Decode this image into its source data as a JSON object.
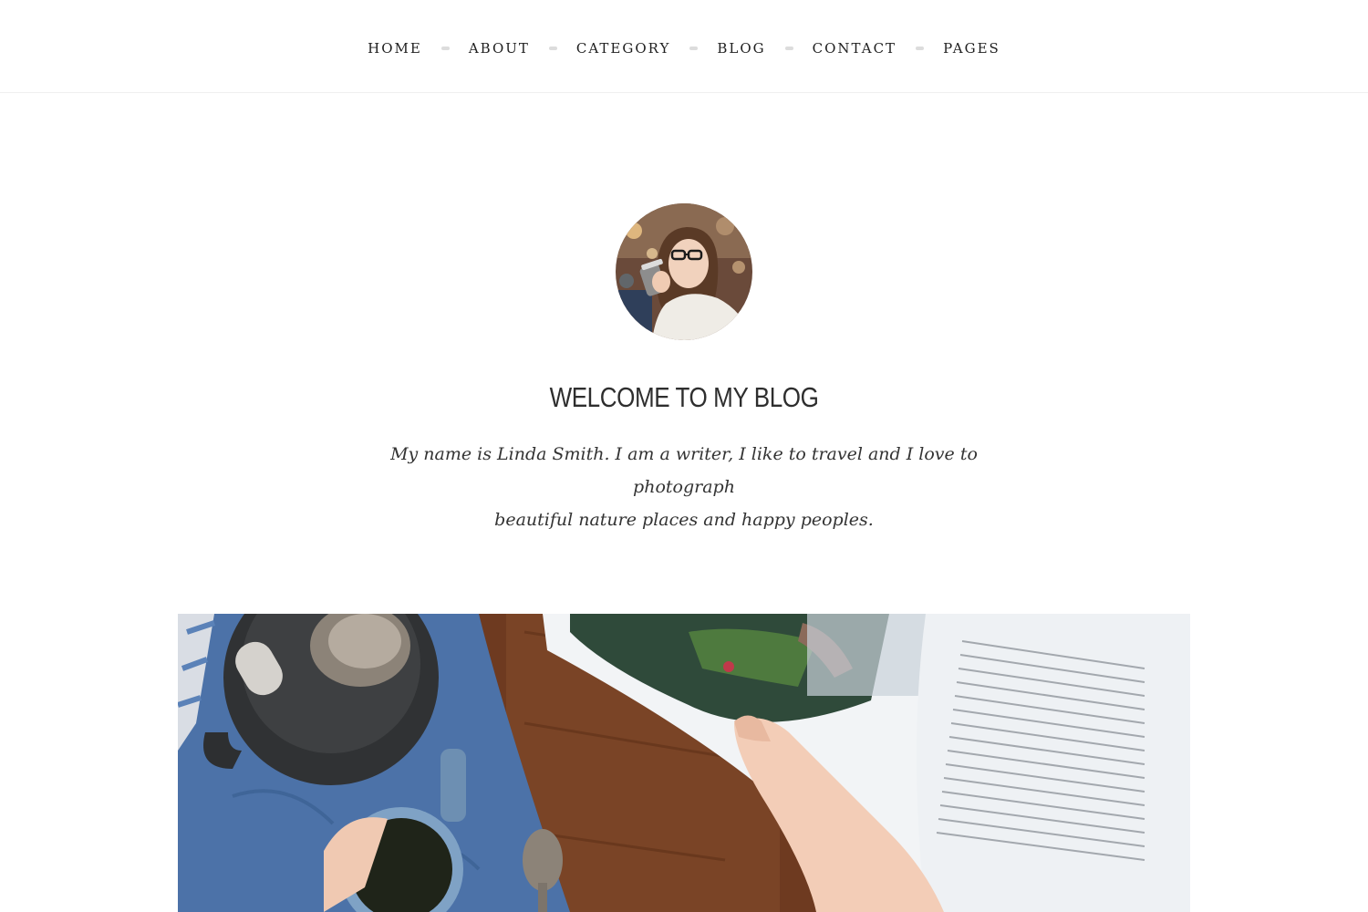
{
  "nav": {
    "items": [
      {
        "label": "HOME"
      },
      {
        "label": "ABOUT"
      },
      {
        "label": "CATEGORY"
      },
      {
        "label": "BLOG"
      },
      {
        "label": "CONTACT"
      },
      {
        "label": "PAGES"
      }
    ]
  },
  "intro": {
    "avatar_icon": "profile-photo-woman-drinking-coffee",
    "title": "WELCOME TO MY BLOG",
    "bio_line1": "My name is Linda Smith. I am a writer, I like to travel and I love to photograph",
    "bio_line2": "beautiful nature places and happy peoples."
  },
  "featured": {
    "image_icon": "photo-coffee-and-magazine"
  },
  "colors": {
    "text": "#2b2b2b",
    "separator": "#dcdcdc",
    "background": "#ffffff"
  }
}
